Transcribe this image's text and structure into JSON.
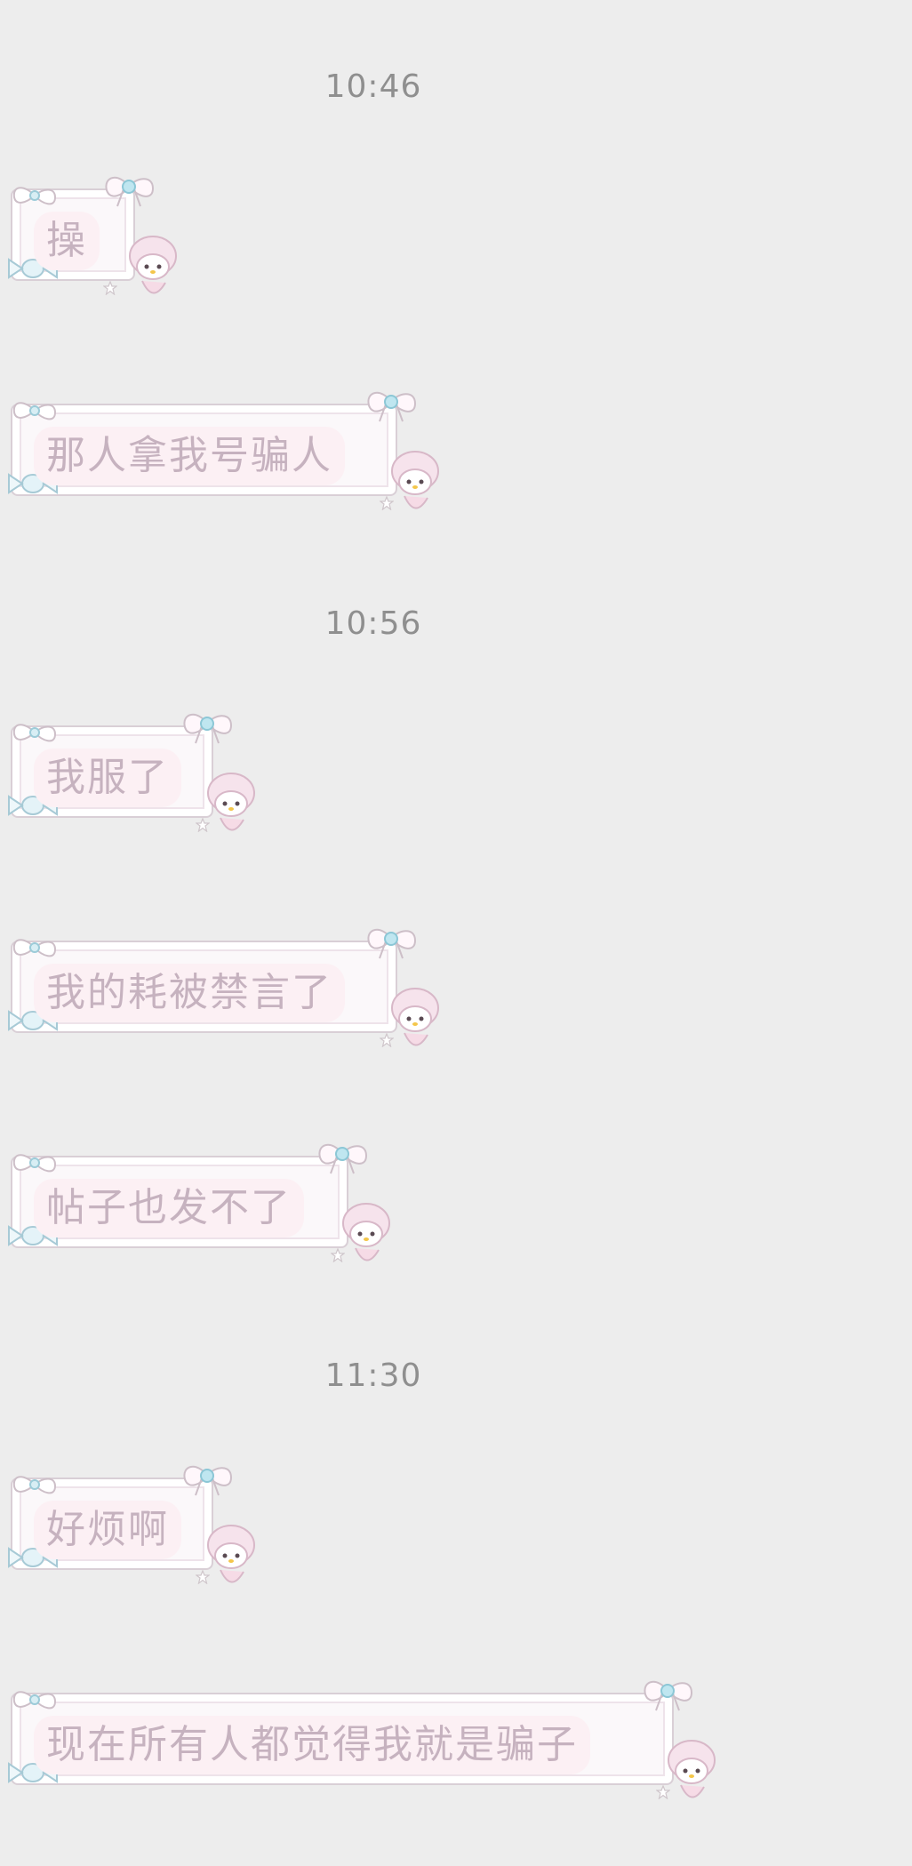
{
  "chat": {
    "timestamps": [
      "10:46",
      "10:56",
      "11:30"
    ],
    "messages": [
      {
        "text": "操"
      },
      {
        "text": "那人拿我号骗人"
      },
      {
        "text": "我服了"
      },
      {
        "text": "我的耗被禁言了"
      },
      {
        "text": "帖子也发不了"
      },
      {
        "text": "好烦啊"
      },
      {
        "text": "现在所有人都觉得我就是骗子"
      }
    ]
  },
  "colors": {
    "background": "#ededed",
    "timestamp": "#8f8f8f",
    "bubble_fill": "#fbf8fa",
    "bubble_border": "#d9cfd6",
    "text": "#c6b2bf",
    "text_highlight": "#fcf0f4",
    "bow_accent": "#a9dbe8",
    "melody_pink": "#f3d7e4"
  },
  "icons": {
    "bow": "bow-icon",
    "candy": "candy-icon",
    "character": "my-melody-icon",
    "star": "star-icon"
  }
}
